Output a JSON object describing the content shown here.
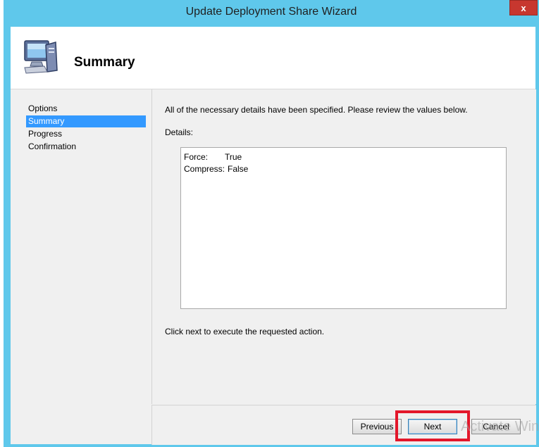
{
  "window": {
    "title": "Update Deployment Share Wizard",
    "close_label": "x"
  },
  "header": {
    "icon": "computer-icon",
    "title": "Summary"
  },
  "nav": {
    "items": [
      {
        "label": "Options",
        "active": false
      },
      {
        "label": "Summary",
        "active": true
      },
      {
        "label": "Progress",
        "active": false
      },
      {
        "label": "Confirmation",
        "active": false
      }
    ]
  },
  "content": {
    "intro": "All of the necessary details have been specified.  Please review the values below.",
    "details_label": "Details:",
    "details": [
      {
        "key": "Force:",
        "value": "True"
      },
      {
        "key": "Compress:",
        "value": "False"
      }
    ],
    "footer": "Click next to execute the requested action."
  },
  "buttons": {
    "previous": "Previous",
    "next": "Next",
    "cancel": "Cancel"
  },
  "watermark": "Activate Win",
  "colors": {
    "titlebar": "#5fc8eb",
    "close": "#c7372f",
    "selection": "#3399ff",
    "highlight": "#e3172b"
  }
}
